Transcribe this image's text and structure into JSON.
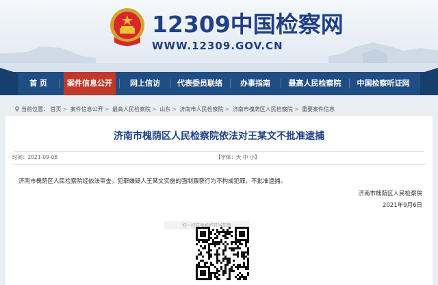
{
  "header": {
    "site_name": "12309中国检察网",
    "site_url": "WWW.12309.GOV.CN",
    "emblem_icon": "national-emblem-icon"
  },
  "nav": {
    "items": [
      {
        "label": "首  页"
      },
      {
        "label": "案件信息公开",
        "active": true
      },
      {
        "label": "网上信访"
      },
      {
        "label": "代表委员联络"
      },
      {
        "label": "办事指南"
      },
      {
        "label": "最高人民检察院"
      },
      {
        "label": "中国检察听证网"
      }
    ]
  },
  "breadcrumb": {
    "prefix": "当前位置：",
    "items": [
      "首页",
      "案件信息公开",
      "最高人民检察院",
      "山东",
      "济南市人民检察院",
      "济南市槐荫区人民检察院",
      "重要案件信息"
    ],
    "separator": ">"
  },
  "article": {
    "title": "济南市槐荫区人民检察院依法对王某文不批准逮捕",
    "date_line": "时间：2021-09-06",
    "font_size_line": "【字体：大   中   小】",
    "body": "济南市槐荫区人民检察院经依法审查，犯罪嫌疑人王某文实施的强制猥亵行为不构成犯罪，不批准逮捕。",
    "sign_org": "济南市槐荫区人民检察院",
    "sign_date": "2021年9月6日",
    "qr_label": "扫一扫在手机打开当前页"
  },
  "colors": {
    "brand_blue": "#1f3f86",
    "nav_bg": "#1f4e85",
    "nav_active": "#c0392b"
  }
}
